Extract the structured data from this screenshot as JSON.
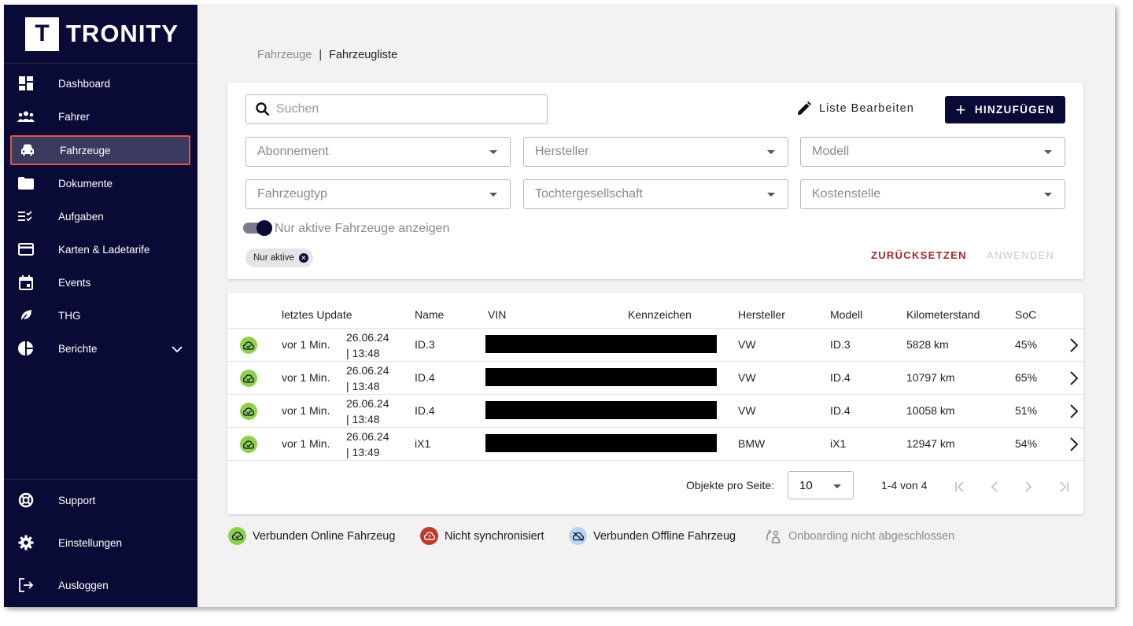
{
  "app": {
    "logo_letter": "T",
    "logo_text": "TRONITY"
  },
  "sidebar": {
    "items": [
      {
        "label": "Dashboard",
        "icon": "dashboard-icon"
      },
      {
        "label": "Fahrer",
        "icon": "people-icon"
      },
      {
        "label": "Fahrzeuge",
        "icon": "car-icon",
        "active": true
      },
      {
        "label": "Dokumente",
        "icon": "folder-icon"
      },
      {
        "label": "Aufgaben",
        "icon": "checklist-icon"
      },
      {
        "label": "Karten & Ladetarife",
        "icon": "card-icon"
      },
      {
        "label": "Events",
        "icon": "calendar-icon"
      },
      {
        "label": "THG",
        "icon": "leaf-icon"
      },
      {
        "label": "Berichte",
        "icon": "pie-chart-icon"
      }
    ],
    "bottom": [
      {
        "label": "Support",
        "icon": "lifebuoy-icon"
      },
      {
        "label": "Einstellungen",
        "icon": "gear-icon"
      },
      {
        "label": "Ausloggen",
        "icon": "logout-icon"
      }
    ]
  },
  "breadcrumb": {
    "parent": "Fahrzeuge",
    "separator": "|",
    "current": "Fahrzeugliste"
  },
  "filters": {
    "search_placeholder": "Suchen",
    "edit_label": "Liste Bearbeiten",
    "add_label": "HINZUFÜGEN",
    "selects": [
      "Abonnement",
      "Hersteller",
      "Modell",
      "Fahrzeugtyp",
      "Tochtergesellschaft",
      "Kostenstelle"
    ],
    "toggle_label": "Nur aktive Fahrzeuge anzeigen",
    "toggle_on": true,
    "chip": "Nur aktive",
    "reset_label": "ZURÜCKSETZEN",
    "apply_label": "ANWENDEN"
  },
  "table": {
    "headers": [
      "letztes Update",
      "Name",
      "VIN",
      "Kennzeichen",
      "Hersteller",
      "Modell",
      "Kilometerstand",
      "SoC"
    ],
    "rows": [
      {
        "update": "vor 1 Min.",
        "date": "26.06.24",
        "time": "| 13:48",
        "name": "ID.3",
        "maker": "VW",
        "model": "ID.3",
        "km": "5828 km",
        "soc": "45%"
      },
      {
        "update": "vor 1 Min.",
        "date": "26.06.24",
        "time": "| 13:48",
        "name": "ID.4",
        "maker": "VW",
        "model": "ID.4",
        "km": "10797 km",
        "soc": "65%"
      },
      {
        "update": "vor 1 Min.",
        "date": "26.06.24",
        "time": "| 13:48",
        "name": "ID.4",
        "maker": "VW",
        "model": "ID.4",
        "km": "10058 km",
        "soc": "51%"
      },
      {
        "update": "vor 1 Min.",
        "date": "26.06.24",
        "time": "| 13:49",
        "name": "iX1",
        "maker": "BMW",
        "model": "iX1",
        "km": "12947 km",
        "soc": "54%"
      }
    ],
    "pager": {
      "per_page_label": "Objekte pro Seite:",
      "per_page": "10",
      "range": "1-4 von 4"
    }
  },
  "legend": [
    {
      "label": "Verbunden Online Fahrzeug",
      "color": "#8ed04a"
    },
    {
      "label": "Nicht synchronisiert",
      "color": "#c0392b"
    },
    {
      "label": "Verbunden Offline Fahrzeug",
      "color": "#b9d6f0"
    },
    {
      "label": "Onboarding nicht abgeschlossen",
      "color": "#8a8a8a"
    }
  ],
  "colors": {
    "sidebar_bg": "#0a0a36",
    "active_border": "#e2553f",
    "accent_red": "#a8262a",
    "online_green": "#8ed04a"
  }
}
